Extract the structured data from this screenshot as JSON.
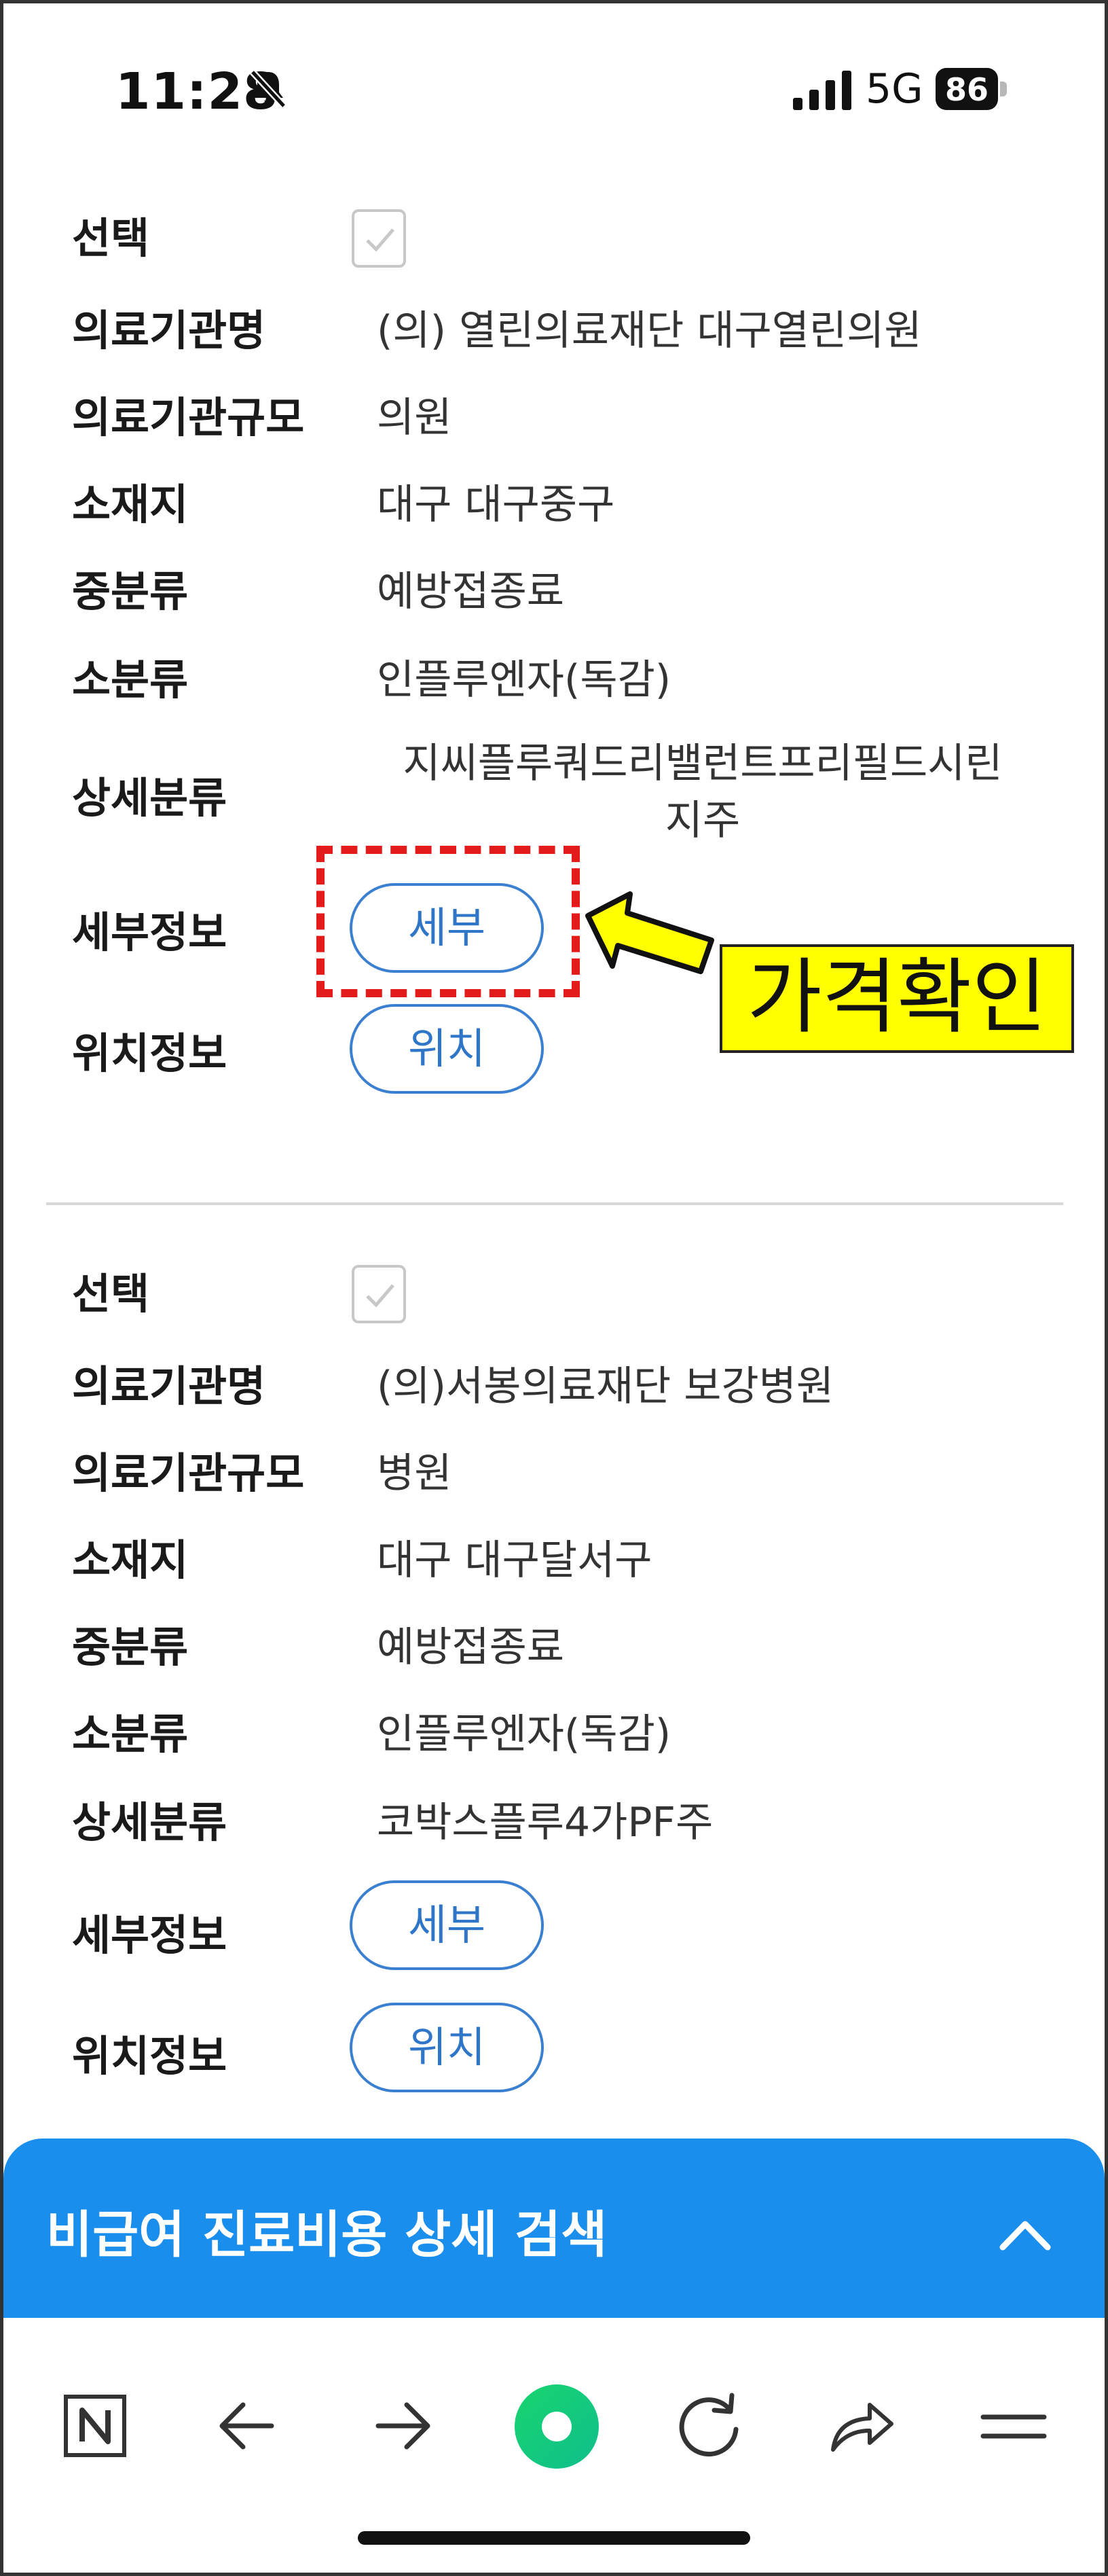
{
  "status_bar": {
    "time": "11:28",
    "network": "5G",
    "battery": "86"
  },
  "records": [
    {
      "select_label": "선택",
      "selected": true,
      "fields": [
        {
          "label": "의료기관명",
          "value": "(의) 열린의료재단 대구열린의원"
        },
        {
          "label": "의료기관규모",
          "value": "의원"
        },
        {
          "label": "소재지",
          "value": "대구 대구중구"
        },
        {
          "label": "중분류",
          "value": "예방접종료"
        },
        {
          "label": "소분류",
          "value": "인플루엔자(독감)"
        }
      ],
      "detail_class": {
        "label": "상세분류",
        "value_line1": "지씨플루쿼드리밸런트프리필드시린",
        "value_line2": "지주"
      },
      "detail_info": {
        "label": "세부정보",
        "button": "세부"
      },
      "location_info": {
        "label": "위치정보",
        "button": "위치"
      }
    },
    {
      "select_label": "선택",
      "selected": true,
      "fields": [
        {
          "label": "의료기관명",
          "value": "(의)서봉의료재단 보강병원"
        },
        {
          "label": "의료기관규모",
          "value": "병원"
        },
        {
          "label": "소재지",
          "value": "대구 대구달서구"
        },
        {
          "label": "중분류",
          "value": "예방접종료"
        },
        {
          "label": "소분류",
          "value": "인플루엔자(독감)"
        },
        {
          "label": "상세분류",
          "value": "코박스플루4가PF주"
        }
      ],
      "detail_info": {
        "label": "세부정보",
        "button": "세부"
      },
      "location_info": {
        "label": "위치정보",
        "button": "위치"
      }
    }
  ],
  "annotation": {
    "callout": "가격확인",
    "box_color": "#e31b1b",
    "callout_bg": "#ffff00",
    "arrow_fill": "#ffff00"
  },
  "search_panel": {
    "title": "비급여 진료비용 상세 검색",
    "bg": "#1a8eec",
    "icon": "chevron-up-icon"
  },
  "toolbar": {
    "icons": [
      "naver-home-icon",
      "back-arrow-icon",
      "forward-arrow-icon",
      "green-dot-icon",
      "reload-icon",
      "share-icon",
      "menu-icon"
    ],
    "accent": "#19d46e"
  },
  "colors": {
    "button_blue": "#2f76c8",
    "divider": "#d7d7d7"
  }
}
